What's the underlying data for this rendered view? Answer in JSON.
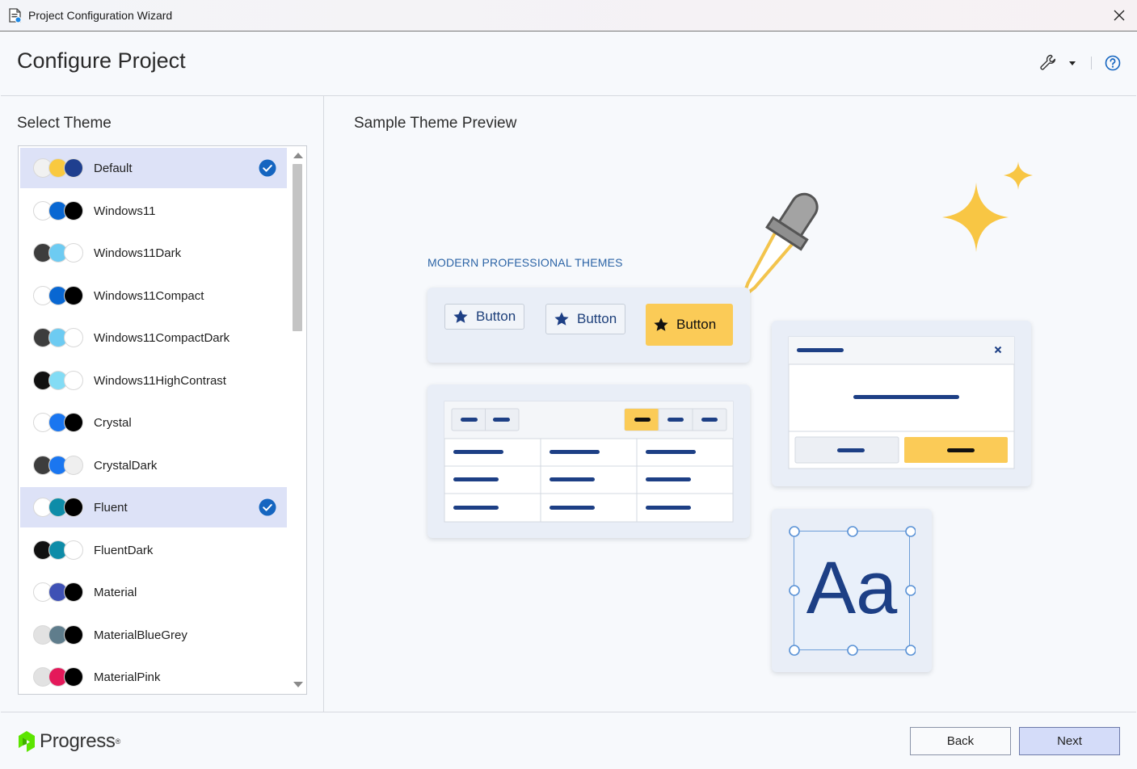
{
  "window": {
    "title": "Project Configuration Wizard"
  },
  "header": {
    "title": "Configure Project"
  },
  "left": {
    "label": "Select Theme",
    "themes": [
      {
        "name": "Default",
        "colors": [
          "#f1f1f1",
          "#f9c940",
          "#1f3f8f"
        ],
        "selected": true
      },
      {
        "name": "Windows11",
        "colors": [
          "#ffffff",
          "#0967d2",
          "#000000"
        ],
        "selected": false
      },
      {
        "name": "Windows11Dark",
        "colors": [
          "#3d3d3d",
          "#6dcbf2",
          "#ffffff"
        ],
        "selected": false
      },
      {
        "name": "Windows11Compact",
        "colors": [
          "#ffffff",
          "#0967d2",
          "#000000"
        ],
        "selected": false
      },
      {
        "name": "Windows11CompactDark",
        "colors": [
          "#3d3d3d",
          "#6dcbf2",
          "#ffffff"
        ],
        "selected": false
      },
      {
        "name": "Windows11HighContrast",
        "colors": [
          "#111111",
          "#83dcf5",
          "#ffffff"
        ],
        "selected": false
      },
      {
        "name": "Crystal",
        "colors": [
          "#ffffff",
          "#1a76f0",
          "#000000"
        ],
        "selected": false
      },
      {
        "name": "CrystalDark",
        "colors": [
          "#3d3d3d",
          "#1a76f0",
          "#efefef"
        ],
        "selected": false
      },
      {
        "name": "Fluent",
        "colors": [
          "#ffffff",
          "#0e8ca8",
          "#000000"
        ],
        "selected": true
      },
      {
        "name": "FluentDark",
        "colors": [
          "#111111",
          "#0e8ca8",
          "#ffffff"
        ],
        "selected": false
      },
      {
        "name": "Material",
        "colors": [
          "#ffffff",
          "#3f51b5",
          "#000000"
        ],
        "selected": false
      },
      {
        "name": "MaterialBlueGrey",
        "colors": [
          "#e2e2e2",
          "#5f7d8c",
          "#000000"
        ],
        "selected": false
      },
      {
        "name": "MaterialPink",
        "colors": [
          "#e2e2e2",
          "#e4195a",
          "#000000"
        ],
        "selected": false
      }
    ]
  },
  "right": {
    "label": "Sample Theme Preview",
    "heading": "MODERN PROFESSIONAL THEMES",
    "buttons": [
      "Button",
      "Button",
      "Button"
    ],
    "typography_sample": "Aa"
  },
  "footer": {
    "logo_text": "Progress",
    "back_label": "Back",
    "next_label": "Next"
  },
  "colors": {
    "accent": "#1565c0",
    "selection": "#dde2f7",
    "preview_navy": "#1d3f85",
    "preview_yellow": "#fbcb57"
  }
}
